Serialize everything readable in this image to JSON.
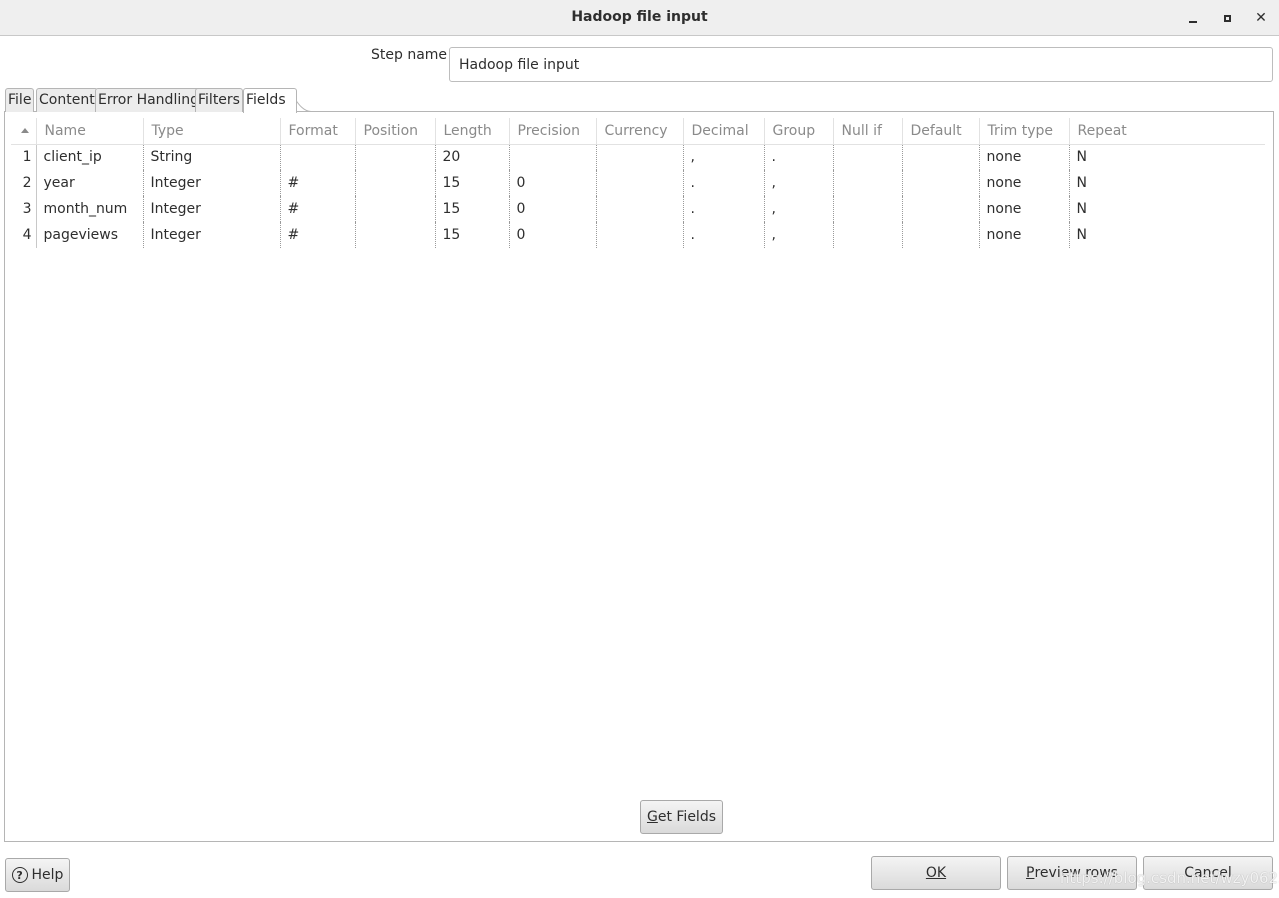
{
  "window": {
    "title": "Hadoop file input"
  },
  "step": {
    "label": "Step name",
    "value": "Hadoop file input"
  },
  "tabs": [
    "File",
    "Content",
    "Error Handling",
    "Filters",
    "Fields"
  ],
  "active_tab": "Fields",
  "table": {
    "columns": [
      "Name",
      "Type",
      "Format",
      "Position",
      "Length",
      "Precision",
      "Currency",
      "Decimal",
      "Group",
      "Null if",
      "Default",
      "Trim type",
      "Repeat"
    ],
    "rows": [
      {
        "num": "1",
        "cells": [
          "client_ip",
          "String",
          "",
          "",
          "20",
          "",
          "",
          ",",
          ".",
          "",
          "",
          "none",
          "N"
        ]
      },
      {
        "num": "2",
        "cells": [
          "year",
          "Integer",
          "#",
          "",
          "15",
          "0",
          "",
          ".",
          ",",
          "",
          "",
          "none",
          "N"
        ]
      },
      {
        "num": "3",
        "cells": [
          "month_num",
          "Integer",
          "#",
          "",
          "15",
          "0",
          "",
          ".",
          ",",
          "",
          "",
          "none",
          "N"
        ]
      },
      {
        "num": "4",
        "cells": [
          "pageviews",
          "Integer",
          "#",
          "",
          "15",
          "0",
          "",
          ".",
          ",",
          "",
          "",
          "none",
          "N"
        ]
      }
    ]
  },
  "buttons": {
    "get_fields": {
      "mnemonic": "G",
      "rest": "et Fields"
    },
    "help": "Help",
    "ok": "OK",
    "preview": {
      "mnemonic": "P",
      "rest": "review rows"
    },
    "cancel": "Cancel"
  },
  "watermark": "https://blog.csdn.net/wzy0623",
  "icons": {
    "minimize": "minimize-icon",
    "maximize": "maximize-icon",
    "close": "close-icon",
    "help": "help-circle-icon",
    "sort": "sort-ascending-icon"
  }
}
